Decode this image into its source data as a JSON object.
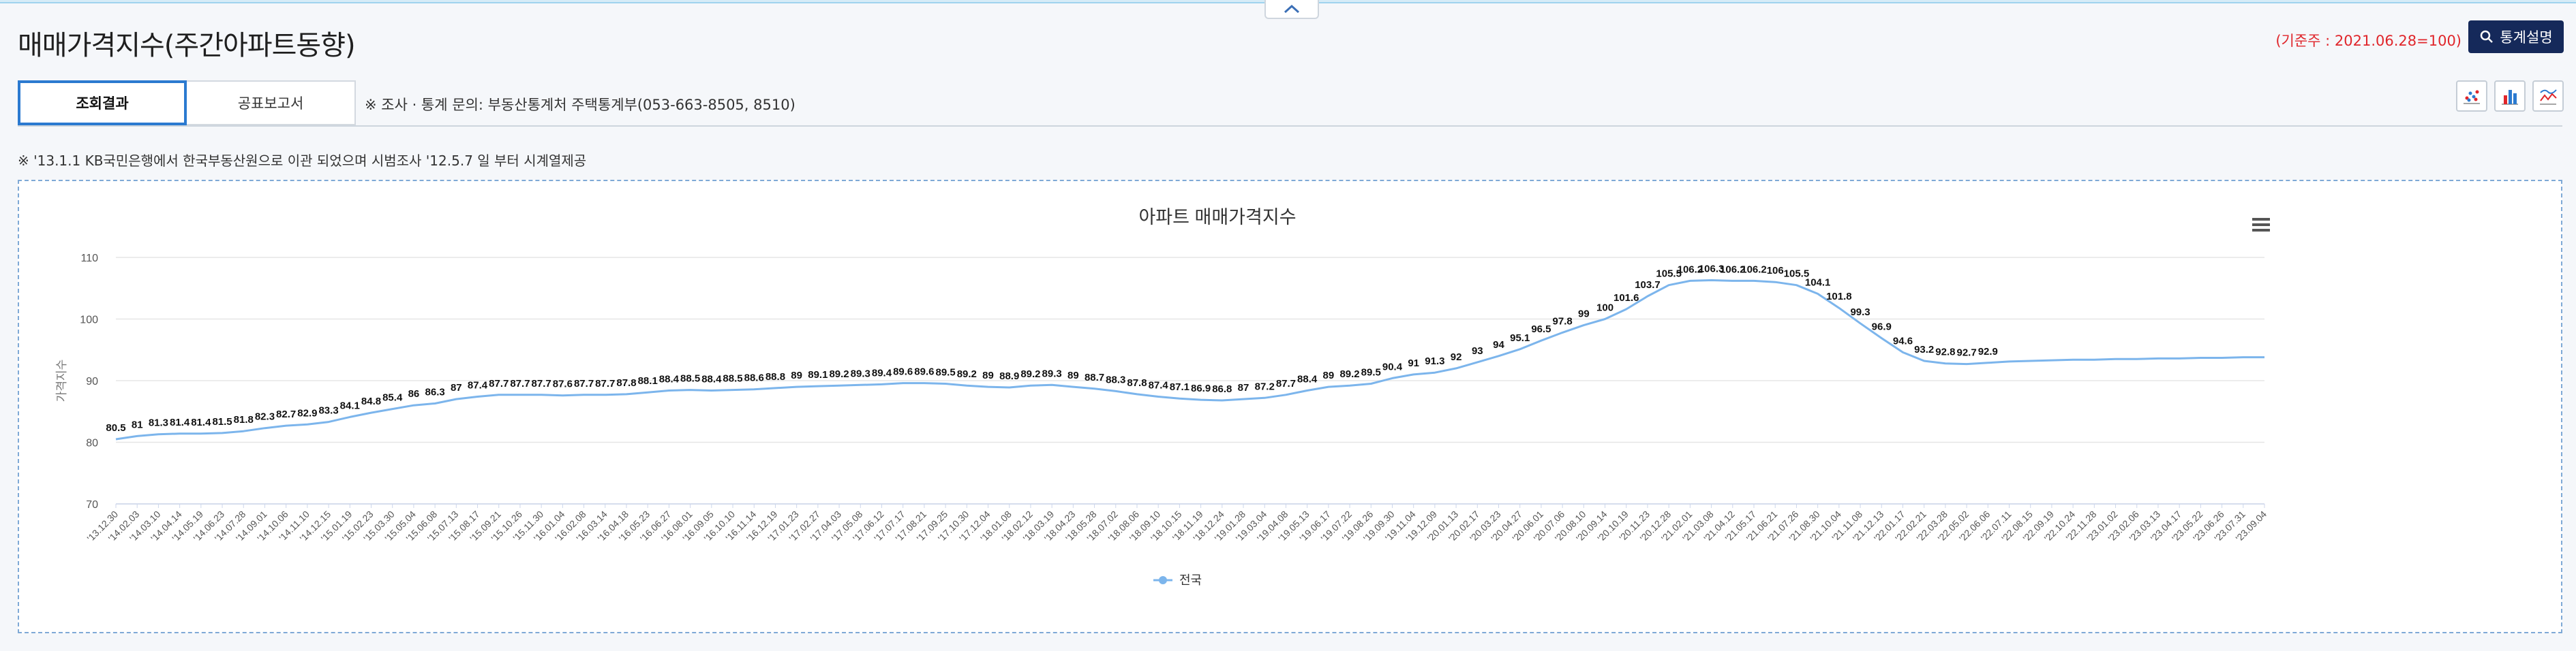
{
  "header": {
    "title": "매매가격지수(주간아파트동향)",
    "base_note": "(기준주 : 2021.06.28=100)",
    "explain_button": "통계설명"
  },
  "tabs": [
    {
      "label": "조회결과",
      "active": true
    },
    {
      "label": "공표보고서",
      "active": false
    }
  ],
  "contact_note": "※ 조사 · 통계 문의: 부동산통계처 주택통계부(053-663-8505, 8510)",
  "notice": "※ '13.1.1 KB국민은행에서 한국부동산원으로 이관 되었으며 시범조사 '12.5.7 일 부터 시계열제공",
  "chart_type_buttons": [
    "scatter-chart-icon",
    "bar-chart-icon",
    "line-chart-icon"
  ],
  "colors": {
    "series": "#7cb5ec",
    "accent": "#15295a",
    "alert": "#e0262b"
  },
  "chart_data": {
    "type": "line",
    "title": "아파트 매매가격지수",
    "ylabel": "가격지수",
    "ylim": [
      70,
      110
    ],
    "yticks": [
      70,
      80,
      90,
      100,
      110
    ],
    "grid": true,
    "legend": "bottom-center",
    "x": [
      "'13.12.30",
      "'14.02.03",
      "'14.03.10",
      "'14.04.14",
      "'14.05.19",
      "'14.06.23",
      "'14.07.28",
      "'14.09.01",
      "'14.10.06",
      "'14.11.10",
      "'14.12.15",
      "'15.01.19",
      "'15.02.23",
      "'15.03.30",
      "'15.05.04",
      "'15.06.08",
      "'15.07.13",
      "'15.08.17",
      "'15.09.21",
      "'15.10.26",
      "'15.11.30",
      "'16.01.04",
      "'16.02.08",
      "'16.03.14",
      "'16.04.18",
      "'16.05.23",
      "'16.06.27",
      "'16.08.01",
      "'16.09.05",
      "'16.10.10",
      "'16.11.14",
      "'16.12.19",
      "'17.01.23",
      "'17.02.27",
      "'17.04.03",
      "'17.05.08",
      "'17.06.12",
      "'17.07.17",
      "'17.08.21",
      "'17.09.25",
      "'17.10.30",
      "'17.12.04",
      "'18.01.08",
      "'18.02.12",
      "'18.03.19",
      "'18.04.23",
      "'18.05.28",
      "'18.07.02",
      "'18.08.06",
      "'18.09.10",
      "'18.10.15",
      "'18.11.19",
      "'18.12.24",
      "'19.01.28",
      "'19.03.04",
      "'19.04.08",
      "'19.05.13",
      "'19.06.17",
      "'19.07.22",
      "'19.08.26",
      "'19.09.30",
      "'19.11.04",
      "'19.12.09",
      "'20.01.13",
      "'20.02.17",
      "'20.03.23",
      "'20.04.27",
      "'20.06.01",
      "'20.07.06",
      "'20.08.10",
      "'20.09.14",
      "'20.10.19",
      "'20.11.23",
      "'20.12.28",
      "'21.02.01",
      "'21.03.08",
      "'21.04.12",
      "'21.05.17",
      "'21.06.21",
      "'21.07.26",
      "'21.08.30",
      "'21.10.04",
      "'21.11.08",
      "'21.12.13",
      "'22.01.17",
      "'22.02.21",
      "'22.03.28",
      "'22.05.02",
      "'22.06.06",
      "'22.07.11",
      "'22.08.15",
      "'22.09.19",
      "'22.10.24",
      "'22.11.28",
      "'23.01.02",
      "'23.02.06",
      "'23.03.13",
      "'23.04.17",
      "'23.05.22",
      "'23.06.26",
      "'23.07.31",
      "'23.09.04"
    ],
    "xticks": [
      "'13.12.30",
      "'14.02.03",
      "'14.03.10",
      "'14.04.14",
      "'14.05.19",
      "'14.06.23",
      "'14.07.28",
      "'14.09.01",
      "'14.10.06",
      "'14.11.10",
      "'14.12.15",
      "'15.01.19",
      "'15.02.23",
      "'15.03.30",
      "'15.05.04",
      "'15.06.08",
      "'15.07.13",
      "'15.08.17",
      "'15.09.21",
      "'15.10.26",
      "'15.11.30",
      "'16.01.04",
      "'16.02.08",
      "'16.03.14",
      "'16.04.18",
      "'16.05.23",
      "'16.06.27",
      "'16.08.01",
      "'16.09.05",
      "'16.10.10",
      "'16.11.14",
      "'16.12.19",
      "'17.01.23",
      "'17.02.27",
      "'17.04.03",
      "'17.05.08",
      "'17.06.12",
      "'17.07.17",
      "'17.08.21",
      "'17.09.25",
      "'17.10.30",
      "'17.12.04",
      "'18.01.08",
      "'18.02.12",
      "'18.03.19",
      "'18.04.23",
      "'18.05.28",
      "'18.07.02",
      "'18.08.06",
      "'18.09.10",
      "'18.10.15",
      "'18.11.19",
      "'18.12.24",
      "'19.01.28",
      "'19.03.04",
      "'19.04.08",
      "'19.05.13",
      "'19.06.17",
      "'19.07.22",
      "'19.08.26",
      "'19.09.30",
      "'19.11.04",
      "'19.12.09",
      "'20.01.13",
      "'20.02.17",
      "'20.03.23",
      "'20.04.27",
      "'20.06.01",
      "'20.07.06",
      "'20.08.10",
      "'20.09.14",
      "'20.10.19",
      "'20.11.23",
      "'20.12.28",
      "'21.02.01",
      "'21.03.08",
      "'21.04.12",
      "'21.05.17",
      "'21.06.21",
      "'21.07.26",
      "'21.08.30",
      "'21.10.04",
      "'21.11.08",
      "'21.12.13",
      "'22.01.17",
      "'22.02.21",
      "'22.03.28",
      "'22.05.02",
      "'22.06.06",
      "'22.07.11",
      "'22.08.15",
      "'22.09.19",
      "'22.10.24",
      "'22.11.28",
      "'23.01.02",
      "'23.02.06",
      "'23.03.13",
      "'23.04.17",
      "'23.05.22",
      "'23.06.26",
      "'23.07.31",
      "'23.09.04"
    ],
    "series": [
      {
        "name": "전국",
        "values": [
          80.5,
          81,
          81.3,
          81.4,
          81.4,
          81.5,
          81.8,
          82.3,
          82.7,
          82.9,
          83.3,
          84.1,
          84.8,
          85.4,
          86,
          86.3,
          87,
          87.4,
          87.7,
          87.7,
          87.7,
          87.6,
          87.7,
          87.7,
          87.8,
          88.1,
          88.4,
          88.5,
          88.4,
          88.5,
          88.6,
          88.8,
          89,
          89.1,
          89.2,
          89.3,
          89.4,
          89.6,
          89.6,
          89.5,
          89.2,
          89,
          88.9,
          89.2,
          89.3,
          89,
          88.7,
          88.3,
          87.8,
          87.4,
          87.1,
          86.9,
          86.8,
          87,
          87.2,
          87.7,
          88.4,
          89,
          89.2,
          89.5,
          90.4,
          91,
          91.3,
          92,
          93,
          94,
          95.1,
          96.5,
          97.8,
          99,
          100,
          101.6,
          103.7,
          105.5,
          106.2,
          106.3,
          106.2,
          106.2,
          106,
          105.5,
          104.1,
          101.8,
          99.3,
          96.9,
          94.6,
          93.2,
          92.8,
          92.7,
          92.9,
          93.1,
          93.2,
          93.3,
          93.4,
          93.4,
          93.5,
          93.5,
          93.6,
          93.6,
          93.7,
          93.7,
          93.8,
          93.8
        ],
        "labels": [
          {
            "i": 0,
            "text": "80.5"
          },
          {
            "i": 1,
            "text": "81"
          },
          {
            "i": 2,
            "text": "81.3"
          },
          {
            "i": 3,
            "text": "81.4"
          },
          {
            "i": 4,
            "text": "81.4"
          },
          {
            "i": 5,
            "text": "81.5"
          },
          {
            "i": 6,
            "text": "81.8"
          },
          {
            "i": 7,
            "text": "82.3"
          },
          {
            "i": 8,
            "text": "82.7"
          },
          {
            "i": 9,
            "text": "82.9"
          },
          {
            "i": 10,
            "text": "83.3"
          },
          {
            "i": 11,
            "text": "84.1"
          },
          {
            "i": 12,
            "text": "84.8"
          },
          {
            "i": 13,
            "text": "85.4"
          },
          {
            "i": 14,
            "text": "86"
          },
          {
            "i": 15,
            "text": "86.3"
          },
          {
            "i": 16,
            "text": "87"
          },
          {
            "i": 17,
            "text": "87.4"
          },
          {
            "i": 18,
            "text": "87.7"
          },
          {
            "i": 19,
            "text": "87.7"
          },
          {
            "i": 20,
            "text": "87.7"
          },
          {
            "i": 21,
            "text": "87.6"
          },
          {
            "i": 22,
            "text": "87.7"
          },
          {
            "i": 23,
            "text": "87.7"
          },
          {
            "i": 24,
            "text": "87.8"
          },
          {
            "i": 25,
            "text": "88.1"
          },
          {
            "i": 26,
            "text": "88.4"
          },
          {
            "i": 27,
            "text": "88.5"
          },
          {
            "i": 28,
            "text": "88.4"
          },
          {
            "i": 29,
            "text": "88.5"
          },
          {
            "i": 30,
            "text": "88.6"
          },
          {
            "i": 31,
            "text": "88.8"
          },
          {
            "i": 32,
            "text": "89"
          },
          {
            "i": 33,
            "text": "89.1"
          },
          {
            "i": 34,
            "text": "89.2"
          },
          {
            "i": 35,
            "text": "89.3"
          },
          {
            "i": 36,
            "text": "89.4"
          },
          {
            "i": 37,
            "text": "89.6"
          },
          {
            "i": 38,
            "text": "89.6"
          },
          {
            "i": 39,
            "text": "89.5"
          },
          {
            "i": 40,
            "text": "89.2"
          },
          {
            "i": 41,
            "text": "89"
          },
          {
            "i": 42,
            "text": "88.9"
          },
          {
            "i": 43,
            "text": "89.2"
          },
          {
            "i": 44,
            "text": "89.3"
          },
          {
            "i": 45,
            "text": "89"
          },
          {
            "i": 46,
            "text": "88.7"
          },
          {
            "i": 47,
            "text": "88.3"
          },
          {
            "i": 48,
            "text": "87.8"
          },
          {
            "i": 49,
            "text": "87.4"
          },
          {
            "i": 50,
            "text": "87.1"
          },
          {
            "i": 51,
            "text": "86.9"
          },
          {
            "i": 52,
            "text": "86.8"
          },
          {
            "i": 53,
            "text": "87"
          },
          {
            "i": 54,
            "text": "87.2"
          },
          {
            "i": 55,
            "text": "87.7"
          },
          {
            "i": 56,
            "text": "88.4"
          },
          {
            "i": 57,
            "text": "89"
          },
          {
            "i": 58,
            "text": "89.2"
          },
          {
            "i": 59,
            "text": "89.5"
          },
          {
            "i": 60,
            "text": "90.4"
          },
          {
            "i": 61,
            "text": "91"
          },
          {
            "i": 62,
            "text": "91.3"
          },
          {
            "i": 63,
            "text": "92"
          },
          {
            "i": 64,
            "text": "93"
          },
          {
            "i": 65,
            "text": "94"
          },
          {
            "i": 66,
            "text": "95.1"
          },
          {
            "i": 67,
            "text": "96.5"
          },
          {
            "i": 68,
            "text": "97.8"
          },
          {
            "i": 69,
            "text": "99"
          },
          {
            "i": 70,
            "text": "100"
          },
          {
            "i": 71,
            "text": "101.6"
          },
          {
            "i": 72,
            "text": "103.7"
          },
          {
            "i": 73,
            "text": "105.5"
          },
          {
            "i": 74,
            "text": "106.2"
          },
          {
            "i": 75,
            "text": "106.3"
          },
          {
            "i": 76,
            "text": "106.2"
          },
          {
            "i": 77,
            "text": "106.2"
          },
          {
            "i": 78,
            "text": "106"
          },
          {
            "i": 79,
            "text": "105.5"
          },
          {
            "i": 80,
            "text": "104.1"
          },
          {
            "i": 81,
            "text": "101.8"
          },
          {
            "i": 82,
            "text": "99.3"
          },
          {
            "i": 83,
            "text": "96.9"
          },
          {
            "i": 84,
            "text": "94.6"
          },
          {
            "i": 85,
            "text": "93.2"
          },
          {
            "i": 86,
            "text": "92.8"
          },
          {
            "i": 87,
            "text": "92.7"
          },
          {
            "i": 88,
            "text": "92.9"
          }
        ]
      }
    ]
  }
}
